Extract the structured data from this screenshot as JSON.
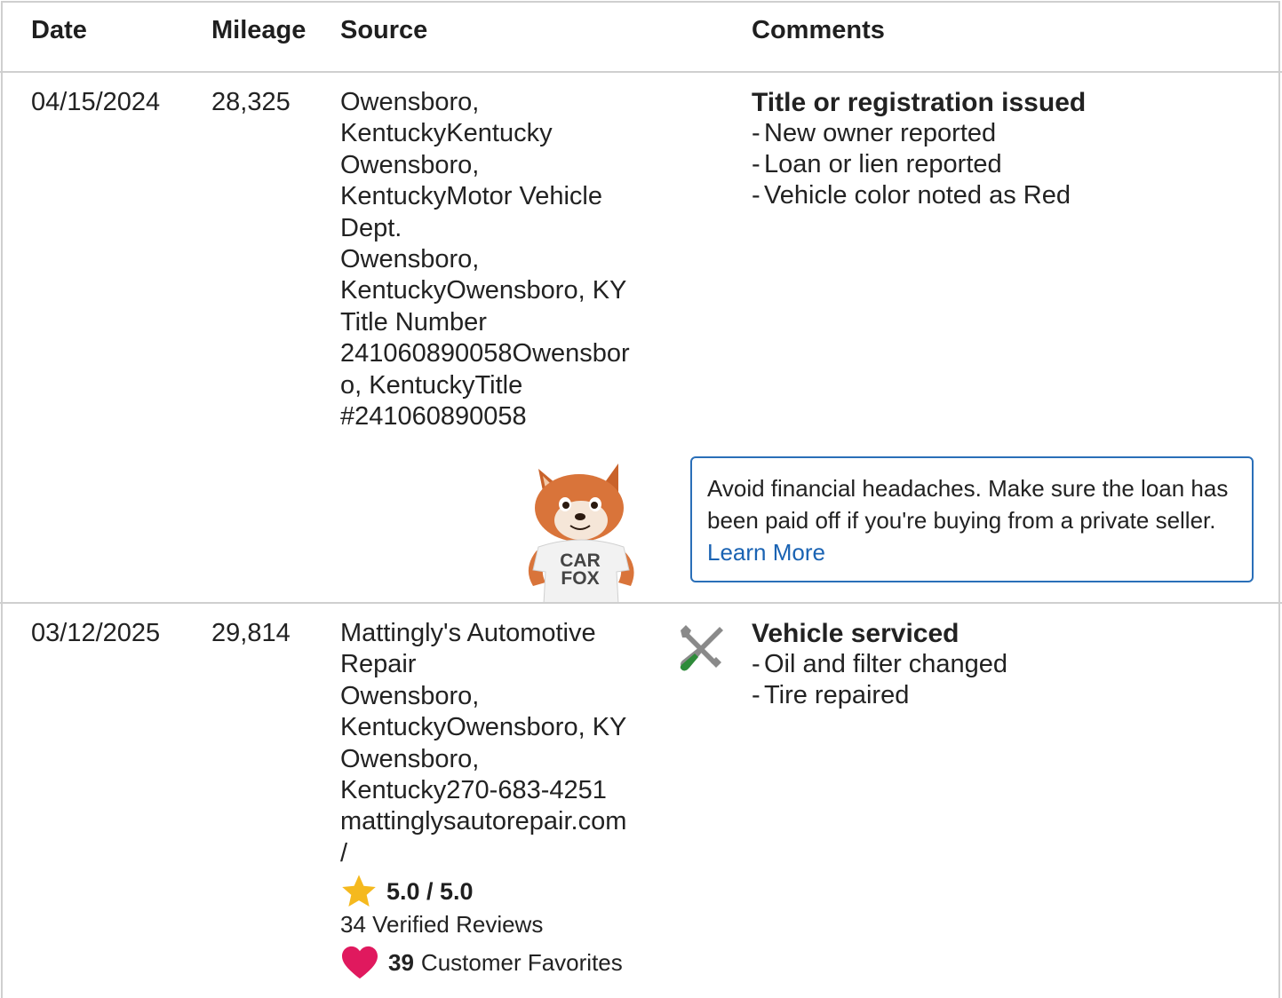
{
  "table": {
    "headers": {
      "date": "Date",
      "mileage": "Mileage",
      "source": "Source",
      "comments": "Comments"
    }
  },
  "records": [
    {
      "date": "04/15/2024",
      "mileage": "28,325",
      "source_lines": [
        "Owensboro,",
        "KentuckyKentucky",
        "Owensboro,",
        "KentuckyMotor Vehicle",
        "Dept.",
        "Owensboro,",
        "KentuckyOwensboro, KY",
        "Title Number",
        "241060890058Owensbor",
        "o, KentuckyTitle",
        "#241060890058"
      ],
      "comment_title": "Title or registration issued",
      "comment_items": [
        "New owner reported",
        "Loan or lien reported",
        "Vehicle color noted as Red"
      ],
      "tip": {
        "text": "Avoid financial headaches. Make sure the loan has been paid off if you're buying from a private seller.",
        "link": "Learn More"
      },
      "mascot": {
        "shirt_line1": "CAR",
        "shirt_line2": "FOX"
      }
    },
    {
      "date": "03/12/2025",
      "mileage": "29,814",
      "source_lines": [
        "Mattingly's Automotive",
        "Repair",
        "Owensboro,",
        "KentuckyOwensboro, KY",
        "Owensboro,",
        "Kentucky270-683-4251",
        "mattinglysautorepair.com",
        "/"
      ],
      "icon": "wrench-screwdriver-icon",
      "comment_title": "Vehicle serviced",
      "comment_items": [
        "Oil and filter changed",
        "Tire repaired"
      ],
      "rating": {
        "value": "5.0 / 5.0",
        "reviews": "34 Verified Reviews",
        "favorites_count": "39",
        "favorites_label": "Customer Favorites"
      }
    }
  ],
  "colors": {
    "border": "#cfcfcf",
    "tip_border": "#2a6fb8",
    "link": "#1a63b3",
    "star": "#f5b91e",
    "heart": "#e0195e",
    "screwdriver": "#2e8b3a"
  },
  "icons": {
    "bullet_dash": "-"
  }
}
